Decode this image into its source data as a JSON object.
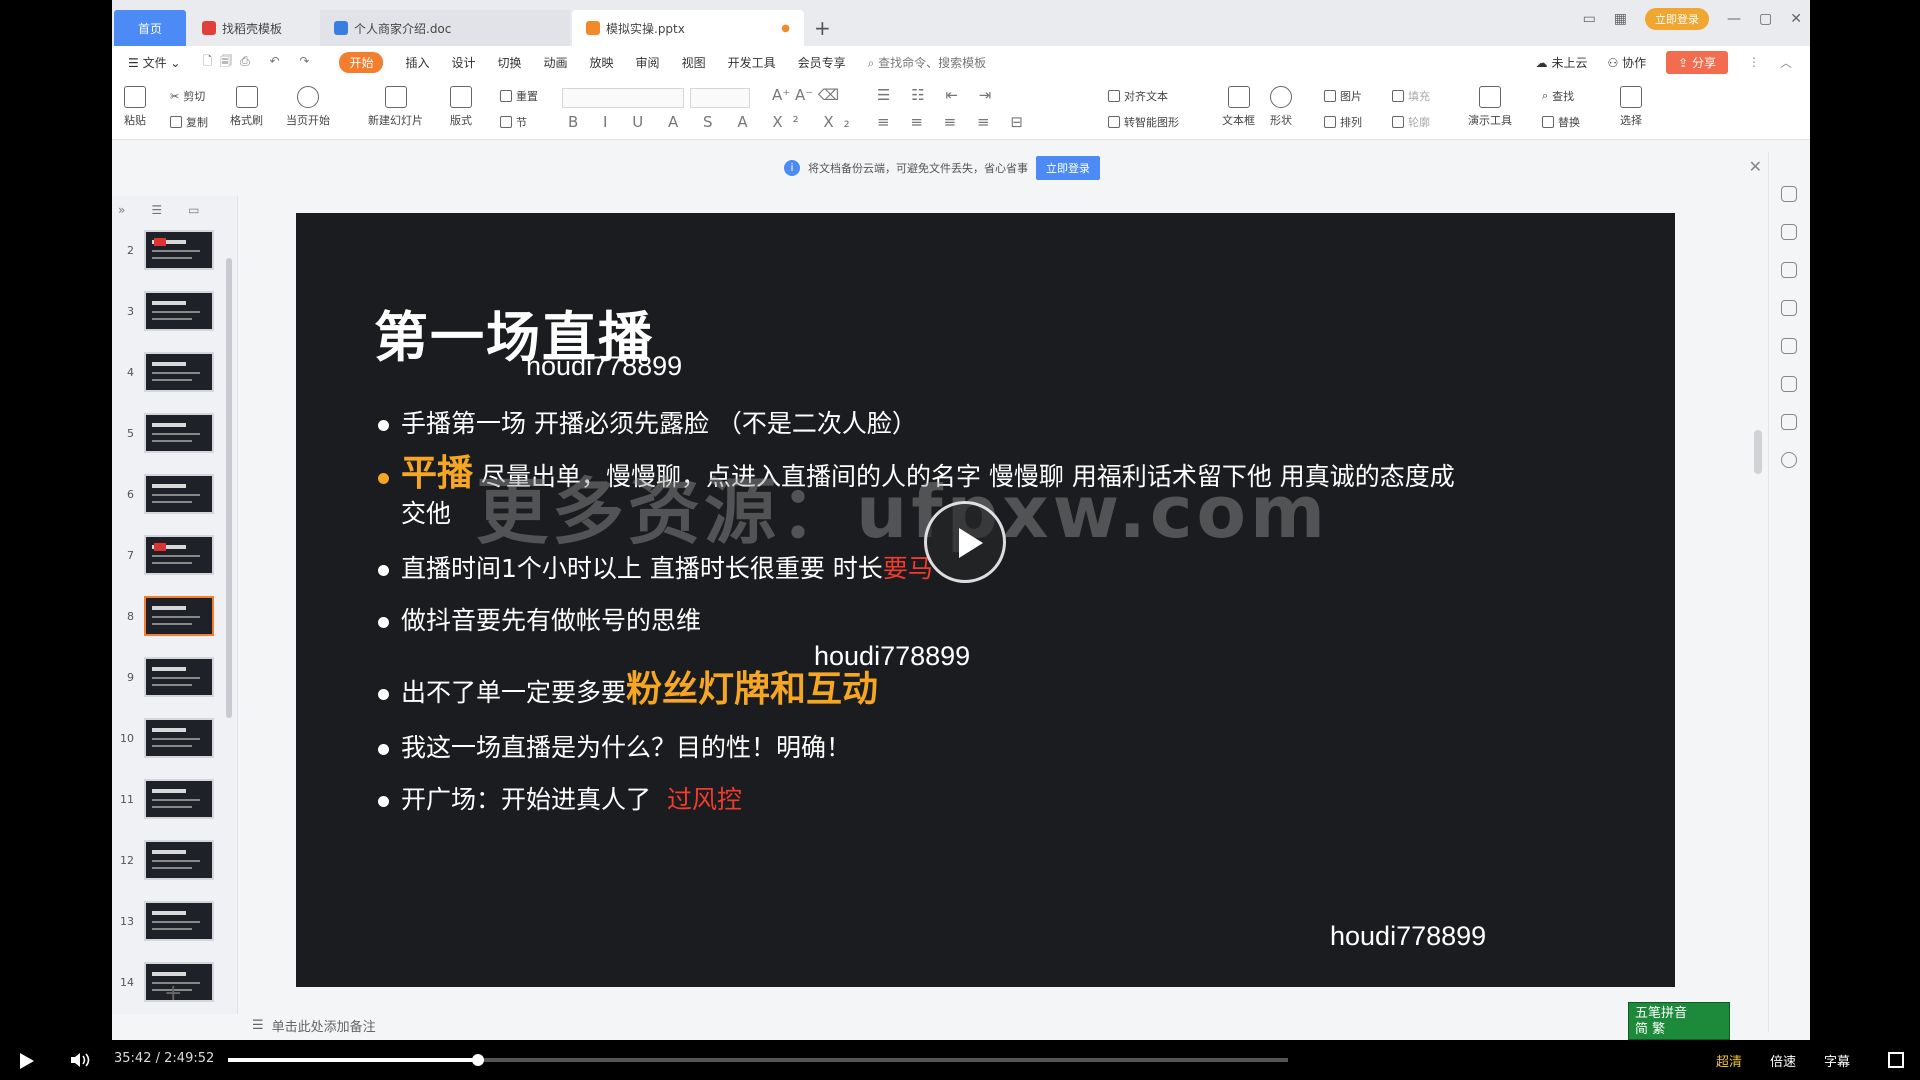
{
  "tabs": {
    "home": "首页",
    "doc1": "找稻壳模板",
    "doc2": "个人商家介绍.doc",
    "active": "模拟实操.pptx"
  },
  "window": {
    "login": "立即登录"
  },
  "menu": {
    "file": "文件",
    "items": [
      "开始",
      "插入",
      "设计",
      "切换",
      "动画",
      "放映",
      "审阅",
      "视图",
      "开发工具",
      "会员专享"
    ],
    "search": "查找命令、搜索模板",
    "cloud": "未上云",
    "collab": "协作",
    "share": "分享"
  },
  "ribbon": {
    "paste": "粘贴",
    "cut": "剪切",
    "copy": "复制",
    "format_painter": "格式刷",
    "play_from_current": "当页开始",
    "new_slide": "新建幻灯片",
    "layout": "版式",
    "section": "节",
    "reset": "重置",
    "align_text": "对齐文本",
    "convert_smartart": "转智能图形",
    "textbox": "文本框",
    "shape": "形状",
    "picture": "图片",
    "arrange": "排列",
    "fill": "填充",
    "outline": "轮廓",
    "present_tools": "演示工具",
    "find": "查找",
    "replace": "替换",
    "select": "选择"
  },
  "notification": {
    "text": "将文档备份云端，可避免文件丢失，省心省事",
    "button": "立即登录"
  },
  "thumbnails": [
    {
      "num": "2"
    },
    {
      "num": "3"
    },
    {
      "num": "4"
    },
    {
      "num": "5"
    },
    {
      "num": "6"
    },
    {
      "num": "7"
    },
    {
      "num": "8"
    },
    {
      "num": "9"
    },
    {
      "num": "10"
    },
    {
      "num": "11"
    },
    {
      "num": "12"
    },
    {
      "num": "13"
    },
    {
      "num": "14"
    }
  ],
  "slide": {
    "title": "第一场直播",
    "watermark_id": "houdi778899",
    "watermark_site": "更多资源：ufpxw.com",
    "bullets": [
      {
        "pre": "手播第一场 开播必须先露脸 （不是二次人脸）"
      },
      {
        "hl": "平播",
        "pre": "尽量出单，慢慢聊，点进入直播间的人的名字 慢慢聊 用福利话术留下他 用真诚的态度成",
        "cont": "交他"
      },
      {
        "pre": "直播时间1个小时以上 直播时长很重要 时长",
        "red": "要马"
      },
      {
        "pre": "做抖音要先有做帐号的思维"
      },
      {
        "pre": "出不了单一定要多要",
        "hl": "粉丝灯牌和互动"
      },
      {
        "pre": "我这一场直播是为什么？目的性！明确！"
      },
      {
        "pre": "开广场：开始进真人了",
        "red": "过风控"
      }
    ]
  },
  "notes": {
    "placeholder": "单击此处添加备注"
  },
  "ime": {
    "line1": "五笔拼音",
    "line2": "简 繁"
  },
  "player": {
    "current": "35:42",
    "sep": "/",
    "total": "2:49:52",
    "progress": 0.236,
    "quality": "超清",
    "speed": "倍速",
    "subtitle": "字幕"
  }
}
